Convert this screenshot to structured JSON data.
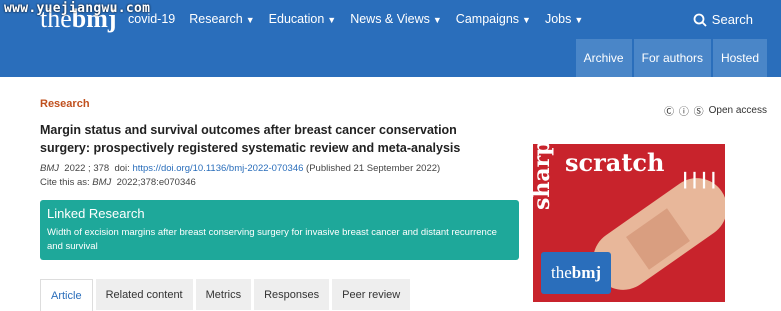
{
  "watermark": "www.yuejiangwu.com",
  "logo": {
    "the": "the",
    "bmj": "bmj"
  },
  "nav": [
    {
      "label": "covid-19",
      "chevron": false
    },
    {
      "label": "Research",
      "chevron": true
    },
    {
      "label": "Education",
      "chevron": true
    },
    {
      "label": "News & Views",
      "chevron": true
    },
    {
      "label": "Campaigns",
      "chevron": true
    },
    {
      "label": "Jobs",
      "chevron": true
    }
  ],
  "search_label": "Search",
  "subnav": [
    "Archive",
    "For authors",
    "Hosted"
  ],
  "section": "Research",
  "open_access": {
    "cc": "Ⓒ ⓘ Ⓢ",
    "label": "Open access"
  },
  "article": {
    "title": "Margin status and survival outcomes after breast cancer conservation surgery: prospectively registered systematic review and meta-analysis",
    "journal": "BMJ",
    "vol": "2022 ; 378",
    "doi_prefix": "doi:",
    "doi": "https://doi.org/10.1136/bmj-2022-070346",
    "published": "(Published 21 September 2022)",
    "cite_prefix": "Cite this as:",
    "cite_journal": "BMJ",
    "cite_ref": "2022;378:e070346"
  },
  "linked": {
    "title": "Linked Research",
    "desc": "Width of excision margins after breast conserving surgery for invasive breast cancer and distant recurrence and survival"
  },
  "tabs": [
    "Article",
    "Related content",
    "Metrics",
    "Responses",
    "Peer review"
  ],
  "ad": {
    "scratch": "scratch",
    "sharp": "sharp",
    "badge_the": "the",
    "badge_bmj": "bmj"
  }
}
